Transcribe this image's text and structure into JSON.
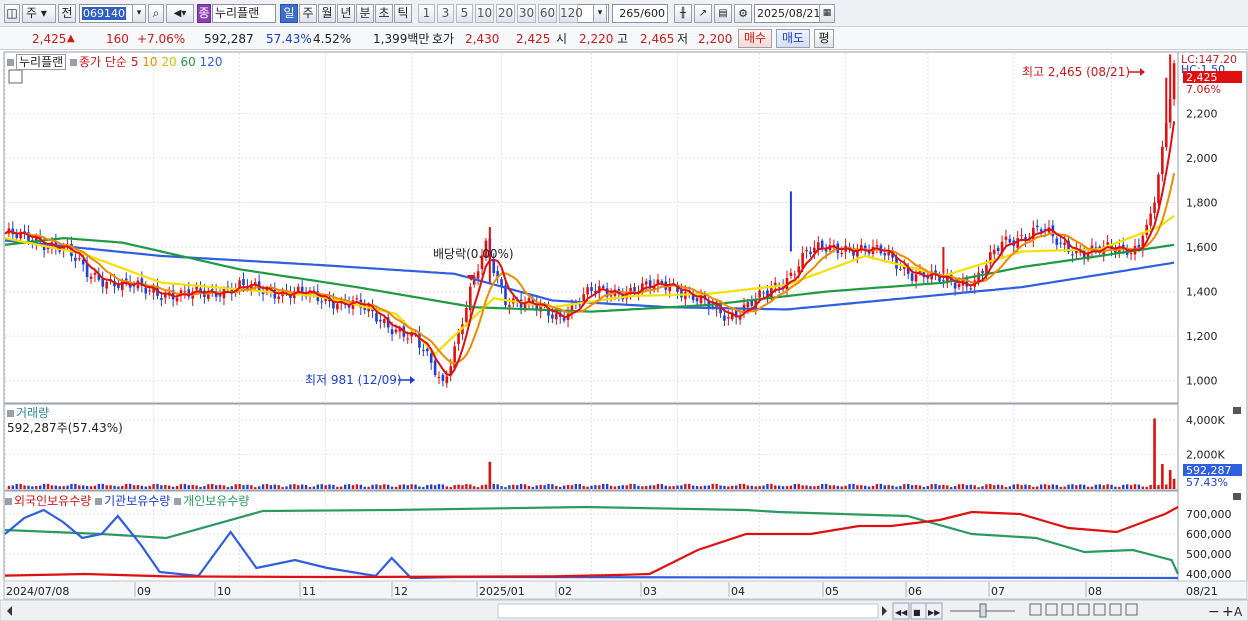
{
  "toolbar": {
    "market_tab": "주",
    "prev_tab": "전",
    "stock_code": "069140",
    "stock_badge": "종",
    "stock_name": "누리플랜",
    "periods": [
      "일",
      "주",
      "월",
      "년",
      "분",
      "초",
      "틱"
    ],
    "selected_period": "일",
    "intervals": [
      "1",
      "3",
      "5",
      "10",
      "20",
      "30",
      "60",
      "120"
    ],
    "count_value": "265",
    "count_total": "/600",
    "date": "2025/08/21"
  },
  "quote": {
    "price": "2,425",
    "change_arrow": "▲",
    "change": "160",
    "change_pct": "+7.06%",
    "volume": "592,287",
    "volume_ratio": "57.43%",
    "turnover_pct": "4.52%",
    "amount": "1,399백만",
    "ask_label": "호가",
    "ask": "2,430",
    "bid": "2,425",
    "open_label": "시",
    "open": "2,220",
    "high_label": "고",
    "high": "2,465",
    "low_label": "저",
    "low": "2,200",
    "buy_label": "매수",
    "sell_label": "매도",
    "eval_label": "평"
  },
  "legend": {
    "name": "누리플랜",
    "ma_label": "종가 단순",
    "ma_periods": [
      "5",
      "10",
      "20",
      "60",
      "120"
    ],
    "volume_title": "거래량",
    "volume_value": "592,287주(57.43%)",
    "holders": [
      "외국인보유수량",
      "기관보유수량",
      "개인보유수량"
    ]
  },
  "annotations": {
    "high": "최고 2,465 (08/21)",
    "low": "최저 981 (12/09)",
    "dividend": "배당락(0.00%)",
    "lc": "LC:147.20",
    "hc": "HC:1.50",
    "price_tag": "2,425",
    "pct_tag": "7.06%",
    "vol_tag": "592,287",
    "vol_pct_tag": "57.43%",
    "axis_end": "08/21"
  },
  "colors": {
    "up": "#e01010",
    "down": "#1f3fd8",
    "ma5": "#e01010",
    "ma10": "#f08a00",
    "ma20": "#f5e000",
    "ma60": "#1f9a40",
    "ma120": "#2f5fe0",
    "foreign": "#e01010",
    "inst": "#2f5fe0",
    "indiv": "#2a9a60"
  },
  "axes": {
    "price_ticks": [
      "2,200",
      "2,000",
      "1,800",
      "1,600",
      "1,400",
      "1,200",
      "1,000"
    ],
    "volume_ticks": [
      "4,000K",
      "2,000K"
    ],
    "holder_ticks": [
      "700,000",
      "600,000",
      "500,000",
      "400,000"
    ],
    "x_labels": [
      "2024/07/08",
      "09",
      "10",
      "11",
      "12",
      "2025/01",
      "02",
      "03",
      "04",
      "05",
      "06",
      "07",
      "08"
    ]
  },
  "chart_data": {
    "type": "line",
    "title": "누리플랜",
    "price_anchors": [
      {
        "d": 0,
        "c": 1660
      },
      {
        "d": 15,
        "c": 1600
      },
      {
        "d": 21,
        "c": 1480
      },
      {
        "d": 30,
        "c": 1430
      },
      {
        "d": 45,
        "c": 1380
      },
      {
        "d": 60,
        "c": 1420
      },
      {
        "d": 75,
        "c": 1390
      },
      {
        "d": 90,
        "c": 1340
      },
      {
        "d": 105,
        "c": 1180
      },
      {
        "d": 110,
        "c": 1050
      },
      {
        "d": 112,
        "c": 990
      },
      {
        "d": 115,
        "c": 1150
      },
      {
        "d": 120,
        "c": 1450
      },
      {
        "d": 123,
        "c": 1600
      },
      {
        "d": 128,
        "c": 1370
      },
      {
        "d": 135,
        "c": 1330
      },
      {
        "d": 142,
        "c": 1290
      },
      {
        "d": 150,
        "c": 1400
      },
      {
        "d": 160,
        "c": 1400
      },
      {
        "d": 170,
        "c": 1440
      },
      {
        "d": 178,
        "c": 1350
      },
      {
        "d": 185,
        "c": 1290
      },
      {
        "d": 195,
        "c": 1390
      },
      {
        "d": 200,
        "c": 1460
      },
      {
        "d": 205,
        "c": 1580
      },
      {
        "d": 215,
        "c": 1600
      },
      {
        "d": 225,
        "c": 1570
      },
      {
        "d": 232,
        "c": 1480
      },
      {
        "d": 240,
        "c": 1450
      },
      {
        "d": 248,
        "c": 1440
      },
      {
        "d": 255,
        "c": 1620
      },
      {
        "d": 265,
        "c": 1680
      },
      {
        "d": 270,
        "c": 1610
      },
      {
        "d": 275,
        "c": 1580
      },
      {
        "d": 285,
        "c": 1590
      },
      {
        "d": 290,
        "c": 1600
      },
      {
        "d": 294,
        "c": 1800
      },
      {
        "d": 296,
        "c": 2050
      },
      {
        "d": 298,
        "c": 2265
      },
      {
        "d": 299,
        "c": 2425
      }
    ],
    "ma_anchors": {
      "ma20": [
        [
          0,
          1640
        ],
        [
          20,
          1570
        ],
        [
          40,
          1440
        ],
        [
          60,
          1410
        ],
        [
          80,
          1380
        ],
        [
          100,
          1300
        ],
        [
          110,
          1120
        ],
        [
          125,
          1370
        ],
        [
          140,
          1330
        ],
        [
          160,
          1380
        ],
        [
          180,
          1390
        ],
        [
          200,
          1430
        ],
        [
          220,
          1560
        ],
        [
          240,
          1470
        ],
        [
          260,
          1580
        ],
        [
          280,
          1590
        ],
        [
          295,
          1690
        ],
        [
          299,
          1740
        ]
      ],
      "ma60": [
        [
          0,
          1610
        ],
        [
          15,
          1640
        ],
        [
          30,
          1620
        ],
        [
          60,
          1500
        ],
        [
          90,
          1420
        ],
        [
          120,
          1330
        ],
        [
          150,
          1310
        ],
        [
          180,
          1340
        ],
        [
          210,
          1400
        ],
        [
          240,
          1440
        ],
        [
          260,
          1510
        ],
        [
          280,
          1560
        ],
        [
          299,
          1610
        ]
      ],
      "ma120": [
        [
          0,
          1630
        ],
        [
          40,
          1560
        ],
        [
          80,
          1520
        ],
        [
          115,
          1480
        ],
        [
          140,
          1360
        ],
        [
          170,
          1330
        ],
        [
          200,
          1320
        ],
        [
          230,
          1370
        ],
        [
          260,
          1420
        ],
        [
          285,
          1490
        ],
        [
          299,
          1530
        ]
      ]
    },
    "volume_spikes_k": [
      {
        "d": 124,
        "v": 1580
      },
      {
        "d": 294,
        "v": 4100
      },
      {
        "d": 296,
        "v": 1450
      },
      {
        "d": 298,
        "v": 1100
      },
      {
        "d": 299,
        "v": 592
      }
    ],
    "holders": {
      "foreign": [
        [
          0,
          392
        ],
        [
          25,
          400
        ],
        [
          50,
          388
        ],
        [
          100,
          385
        ],
        [
          170,
          388
        ],
        [
          190,
          395
        ],
        [
          200,
          400
        ],
        [
          215,
          520
        ],
        [
          230,
          600
        ],
        [
          250,
          600
        ],
        [
          265,
          640
        ],
        [
          275,
          640
        ],
        [
          290,
          670
        ],
        [
          300,
          710
        ],
        [
          315,
          700
        ],
        [
          330,
          630
        ],
        [
          345,
          610
        ],
        [
          360,
          700
        ],
        [
          364,
          735
        ]
      ],
      "institution": [
        [
          0,
          600
        ],
        [
          6,
          680
        ],
        [
          12,
          720
        ],
        [
          18,
          660
        ],
        [
          24,
          580
        ],
        [
          30,
          600
        ],
        [
          35,
          690
        ],
        [
          42,
          550
        ],
        [
          48,
          410
        ],
        [
          60,
          390
        ],
        [
          70,
          610
        ],
        [
          78,
          430
        ],
        [
          90,
          470
        ],
        [
          100,
          430
        ],
        [
          115,
          390
        ],
        [
          120,
          480
        ],
        [
          126,
          380
        ],
        [
          140,
          385
        ],
        [
          364,
          380
        ]
      ],
      "individual": [
        [
          0,
          620
        ],
        [
          30,
          600
        ],
        [
          50,
          580
        ],
        [
          80,
          715
        ],
        [
          120,
          720
        ],
        [
          180,
          735
        ],
        [
          230,
          720
        ],
        [
          240,
          710
        ],
        [
          280,
          690
        ],
        [
          300,
          600
        ],
        [
          320,
          580
        ],
        [
          335,
          510
        ],
        [
          350,
          520
        ],
        [
          362,
          470
        ],
        [
          364,
          400
        ]
      ]
    },
    "ylim": [
      900,
      2480
    ],
    "grid": true
  }
}
